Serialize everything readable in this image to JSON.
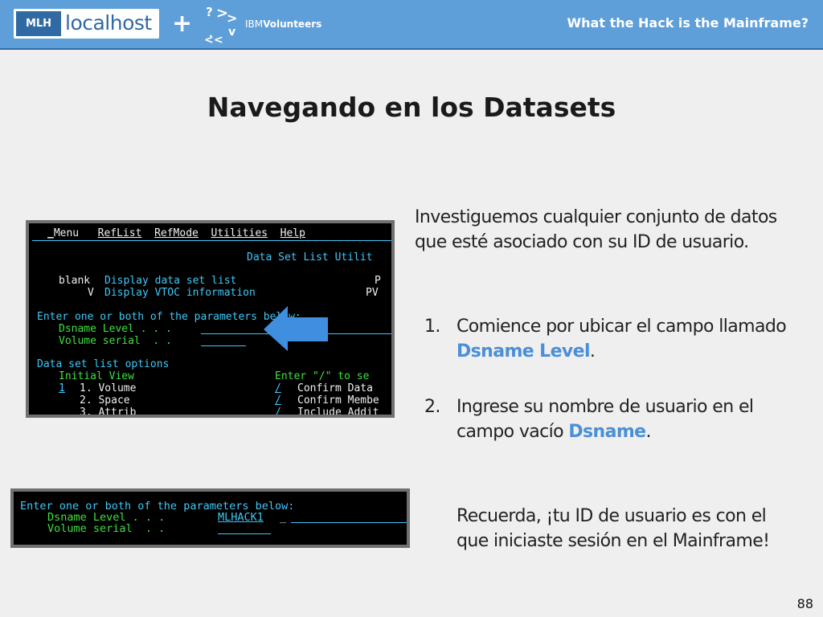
{
  "header": {
    "mlh_badge": "MLH",
    "mlh_name": "localhost",
    "plus": "+",
    "ibm_prefix": "IBM",
    "ibm_name": "Volunteers",
    "title": "What the Hack is the Mainframe?",
    "bar_color": "#5f9fd9"
  },
  "slide": {
    "title": "Navegando en los Datasets",
    "page_number": "88"
  },
  "terminal1": {
    "menu": {
      "menu": "Menu",
      "reflist": "RefList",
      "refmode": "RefMode",
      "utilities": "Utilities",
      "help": "Help"
    },
    "panel_title": "Data Set List Utilit",
    "rows": {
      "blank_key": "blank",
      "blank_desc": "Display data set list",
      "blank_p": "P",
      "v_key": "V",
      "v_desc": "Display VTOC information",
      "v_pv": "PV",
      "enter": "Enter one or both of the parameters below:",
      "dsname": "Dsname Level . . .",
      "volume": "Volume serial  . .",
      "options": "Data set list options",
      "initial_view": "Initial View",
      "enter_slash": "Enter \"/\" to se",
      "view1_sel": "1",
      "view1": "1. Volume",
      "opt1": "Confirm Data",
      "view2": "2. Space",
      "opt2": "Confirm Membe",
      "view3": "3. Attrib",
      "opt3": "Include Addit",
      "slash": "/"
    }
  },
  "terminal2": {
    "enter": "Enter one or both of the parameters below:",
    "dsname": "Dsname Level . . .",
    "dsname_value": "MLHACK1",
    "volume": "Volume serial  . ."
  },
  "text": {
    "intro": "Investiguemos cualquier conjunto de datos que esté asociado con su ID de usuario.",
    "step1_num": "1.",
    "step1_a": "Comience por ubicar el campo llamado ",
    "step1_hl": "Dsname Level",
    "step1_b": ".",
    "step2_num": "2.",
    "step2_a": "Ingrese su nombre de usuario en el campo vacío ",
    "step2_hl": "Dsname",
    "step2_b": ".",
    "reminder": "Recuerda, ¡tu ID de usuario es con el que iniciaste sesión en el Mainframe!"
  },
  "colors": {
    "terminal_cyan": "#3fc8f8",
    "terminal_green": "#40e040",
    "terminal_white": "#f0f0f0",
    "highlight": "#4a8fd8",
    "arrow": "#3f8ee0"
  },
  "icons": {
    "ibm_mark": "ibm-volunteers-arrows-icon",
    "pointer": "left-arrow-icon"
  }
}
